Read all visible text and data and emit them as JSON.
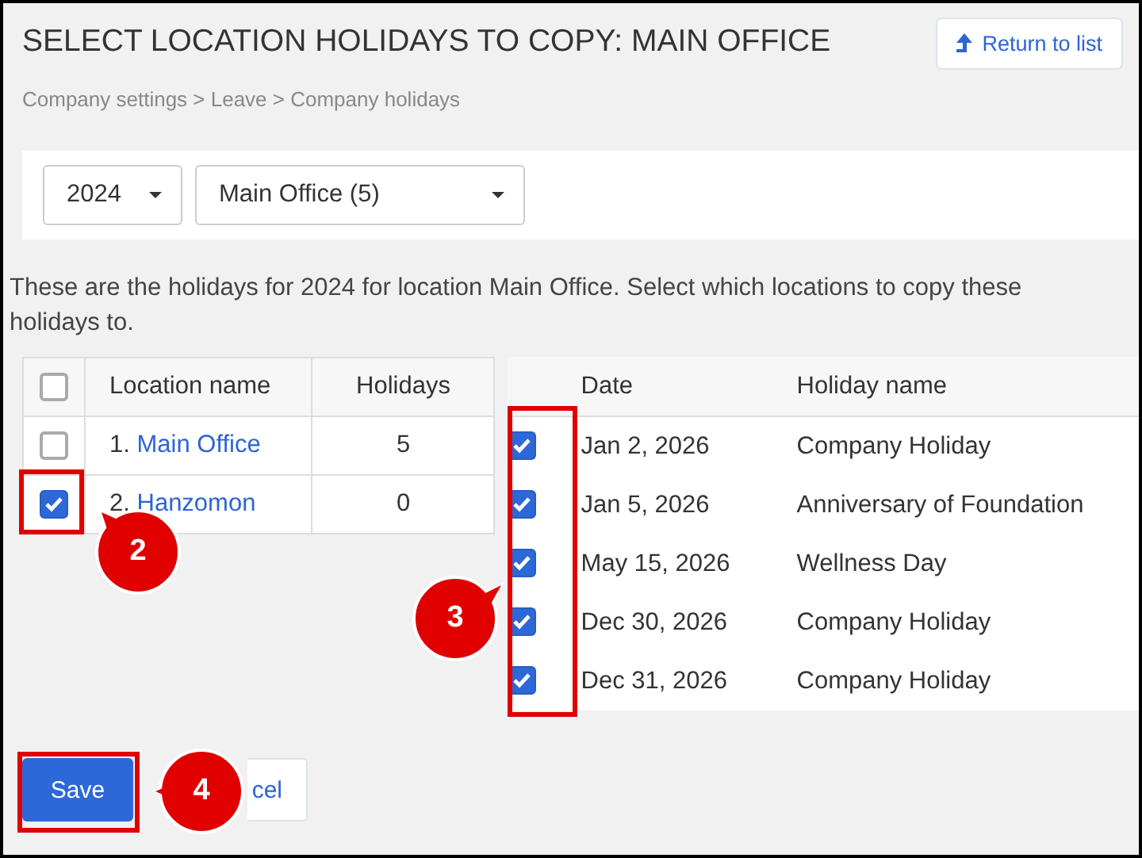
{
  "title": "SELECT LOCATION HOLIDAYS TO COPY: MAIN OFFICE",
  "return_button": "Return to list",
  "breadcrumb": "Company settings > Leave > Company holidays",
  "year_dropdown": "2024",
  "location_dropdown": "Main Office (5)",
  "description": "These are the holidays for 2024 for location Main Office. Select which locations to copy these holidays to.",
  "locations_table": {
    "select_all_checked": false,
    "columns": [
      "Location name",
      "Holidays"
    ],
    "rows": [
      {
        "index": "1.",
        "name": "Main Office",
        "holidays": "5",
        "checked": false
      },
      {
        "index": "2.",
        "name": "Hanzomon",
        "holidays": "0",
        "checked": true
      }
    ]
  },
  "holidays_table": {
    "columns": [
      "Date",
      "Holiday name"
    ],
    "rows": [
      {
        "date": "Jan 2, 2026",
        "name": "Company Holiday",
        "checked": true
      },
      {
        "date": "Jan 5, 2026",
        "name": "Anniversary of Foundation",
        "checked": true
      },
      {
        "date": "May 15, 2026",
        "name": "Wellness Day",
        "checked": true
      },
      {
        "date": "Dec 30, 2026",
        "name": "Company Holiday",
        "checked": true
      },
      {
        "date": "Dec 31, 2026",
        "name": "Company Holiday",
        "checked": true
      }
    ]
  },
  "buttons": [
    {
      "label": "Save",
      "kind": "primary"
    },
    {
      "label": "cel",
      "kind": "secondary"
    }
  ],
  "callouts": [
    {
      "number": "2",
      "kind": "up-left"
    },
    {
      "number": "3",
      "kind": "right"
    },
    {
      "number": "4",
      "kind": "left"
    }
  ]
}
